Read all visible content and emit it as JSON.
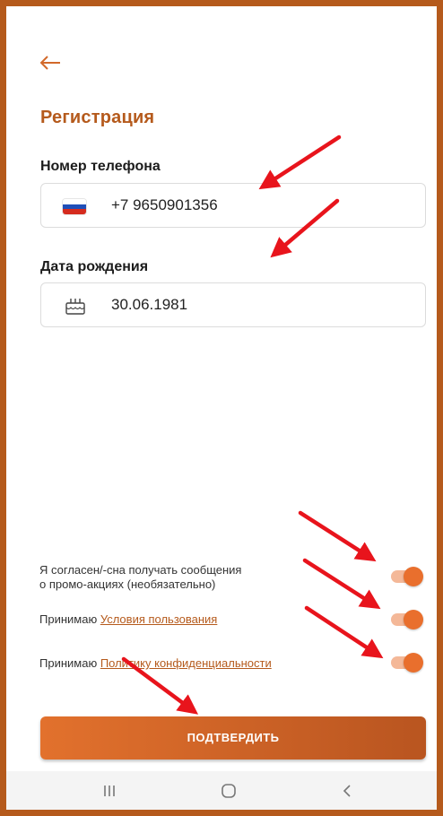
{
  "header": {
    "title": "Регистрация",
    "back_icon": "arrow-left-icon"
  },
  "form": {
    "phone": {
      "label": "Номер телефона",
      "flag_icon": "russia-flag-icon",
      "value": "+7 9650901356"
    },
    "birthdate": {
      "label": "Дата рождения",
      "calendar_icon": "cake-calendar-icon",
      "value": "30.06.1981"
    }
  },
  "consents": [
    {
      "line1": "Я согласен/-сна получать сообщения",
      "line2": "о промо-акциях (необязательно)",
      "enabled": true
    },
    {
      "prefix": "Принимаю ",
      "link": "Условия пользования",
      "enabled": true
    },
    {
      "prefix": "Принимаю ",
      "link": "Политику конфиденциальности",
      "enabled": true
    }
  ],
  "confirm_button": {
    "label": "ПОДТВЕРДИТЬ"
  },
  "navbar": {
    "recent_icon": "recent-apps-icon",
    "home_icon": "home-icon",
    "back_icon": "back-chevron-icon"
  },
  "colors": {
    "accent": "#b55a1c",
    "button_start": "#e2712d",
    "button_end": "#b95520",
    "annotation": "#e8141c"
  }
}
